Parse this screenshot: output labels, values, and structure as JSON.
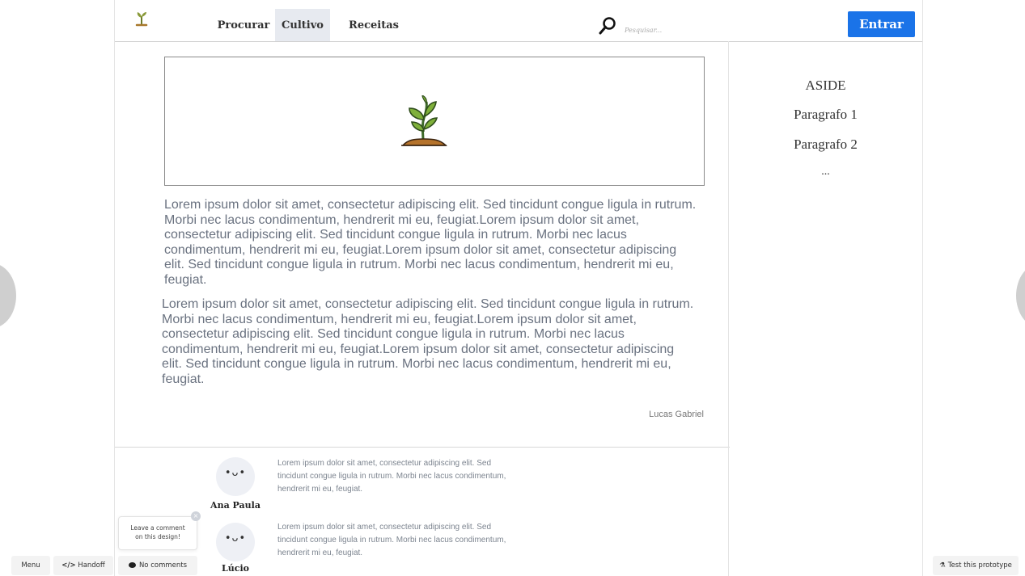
{
  "nav": {
    "items": [
      {
        "label": "Procurar",
        "active": false
      },
      {
        "label": "Cultivo",
        "active": true
      },
      {
        "label": "Receitas",
        "active": false
      }
    ],
    "search_placeholder": "Pesquisar...",
    "login_label": "Entrar"
  },
  "article": {
    "hero_icon": "sprout-icon",
    "paragraphs": [
      "Lorem ipsum dolor sit amet, consectetur adipiscing elit. Sed tincidunt congue ligula in rutrum. Morbi nec lacus condimentum, hendrerit mi eu, feugiat.Lorem ipsum dolor sit amet, consectetur adipiscing elit. Sed tincidunt congue ligula in rutrum. Morbi nec lacus condimentum, hendrerit mi eu, feugiat.Lorem ipsum dolor sit amet, consectetur adipiscing elit. Sed tincidunt congue ligula in rutrum. Morbi nec lacus condimentum, hendrerit mi eu, feugiat.",
      "Lorem ipsum dolor sit amet, consectetur adipiscing elit. Sed tincidunt congue ligula in rutrum. Morbi nec lacus condimentum, hendrerit mi eu, feugiat.Lorem ipsum dolor sit amet, consectetur adipiscing elit. Sed tincidunt congue ligula in rutrum. Morbi nec lacus condimentum, hendrerit mi eu, feugiat.Lorem ipsum dolor sit amet, consectetur adipiscing elit. Sed tincidunt congue ligula in rutrum. Morbi nec lacus condimentum, hendrerit mi eu, feugiat."
    ],
    "author": "Lucas Gabriel"
  },
  "aside": {
    "items": [
      "ASIDE",
      "Paragrafo 1",
      "Paragrafo 2",
      "..."
    ]
  },
  "comments": [
    {
      "name": "Ana Paula",
      "avatar_face": "•ᴗ•",
      "text": "Lorem ipsum dolor sit amet, consectetur adipiscing elit. Sed tincidunt congue ligula in rutrum. Morbi nec lacus condimentum, hendrerit mi eu, feugiat."
    },
    {
      "name": "Lúcio",
      "avatar_face": "•ᴗ•",
      "text": "Lorem ipsum dolor sit amet, consectetur adipiscing elit. Sed tincidunt congue ligula in rutrum. Morbi nec lacus condimentum, hendrerit mi eu, feugiat."
    }
  ],
  "toolbar": {
    "menu_label": "Menu",
    "handoff_label": "Handoff",
    "comments_label": "No comments",
    "test_label": "Test this prototype",
    "tooltip_line1": "Leave a comment",
    "tooltip_line2": "on this design!",
    "tooltip_close": "×"
  },
  "colors": {
    "accent": "#1a73e8",
    "nav_active_bg": "#e7eaf0",
    "body_text": "#6a7280"
  }
}
